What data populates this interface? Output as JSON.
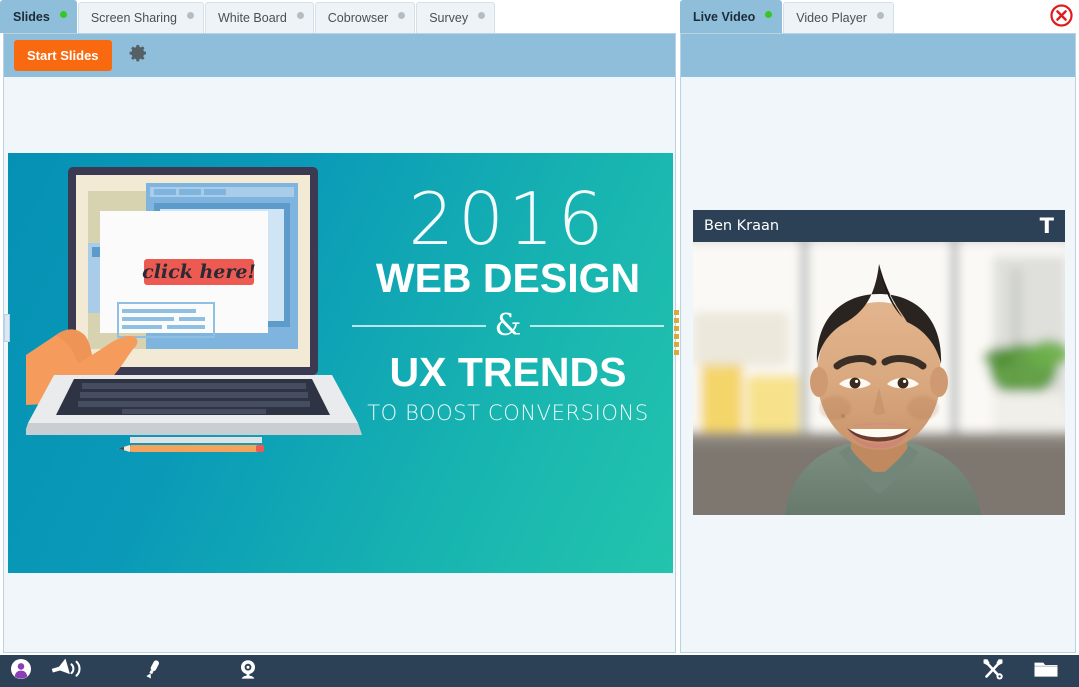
{
  "window": {
    "close_label": "close-session"
  },
  "left_panel": {
    "tabs": [
      {
        "label": "Slides",
        "status": "active",
        "icon": "status-dot-icon"
      },
      {
        "label": "Screen Sharing",
        "status": "inactive",
        "icon": "status-dot-icon"
      },
      {
        "label": "White Board",
        "status": "inactive",
        "icon": "status-dot-icon"
      },
      {
        "label": "Cobrowser",
        "status": "inactive",
        "icon": "status-dot-icon"
      },
      {
        "label": "Survey",
        "status": "inactive",
        "icon": "status-dot-icon"
      }
    ],
    "toolbar": {
      "start_label": "Start Slides",
      "settings_icon": "gear-icon"
    },
    "slide": {
      "year": "2016",
      "line2": "WEB DESIGN",
      "ampersand": "&",
      "line3": "UX TRENDS",
      "line4": "TO BOOST CONVERSIONS",
      "cta_button": "click here!",
      "background_color": "#0a9ab8"
    }
  },
  "right_panel": {
    "tabs": [
      {
        "label": "Live Video",
        "status": "active",
        "icon": "status-dot-icon"
      },
      {
        "label": "Video Player",
        "status": "inactive",
        "icon": "status-dot-icon"
      }
    ],
    "video": {
      "participant_name": "Ben Kraan",
      "text_icon": "text-tool-icon"
    }
  },
  "splitter": {
    "handle_icon": "drag-handle-icon",
    "collapse_icon": "collapse-arrow-icon"
  },
  "bottom_bar": {
    "left_icons": [
      {
        "name": "participants-icon",
        "label": "Participants"
      },
      {
        "name": "speaker-volume-icon",
        "label": "Speaker"
      },
      {
        "name": "microphone-icon",
        "label": "Microphone"
      },
      {
        "name": "webcam-icon",
        "label": "Webcam"
      }
    ],
    "right_icons": [
      {
        "name": "tools-icon",
        "label": "Tools"
      },
      {
        "name": "folder-icon",
        "label": "Files"
      }
    ]
  },
  "colors": {
    "accent_orange": "#f96a10",
    "toolbar_blue": "#8fbedb",
    "panel_bg": "#f1f6fa",
    "dark_navy": "#2c4155",
    "status_green": "#35c724",
    "close_red": "#e01b1b"
  }
}
